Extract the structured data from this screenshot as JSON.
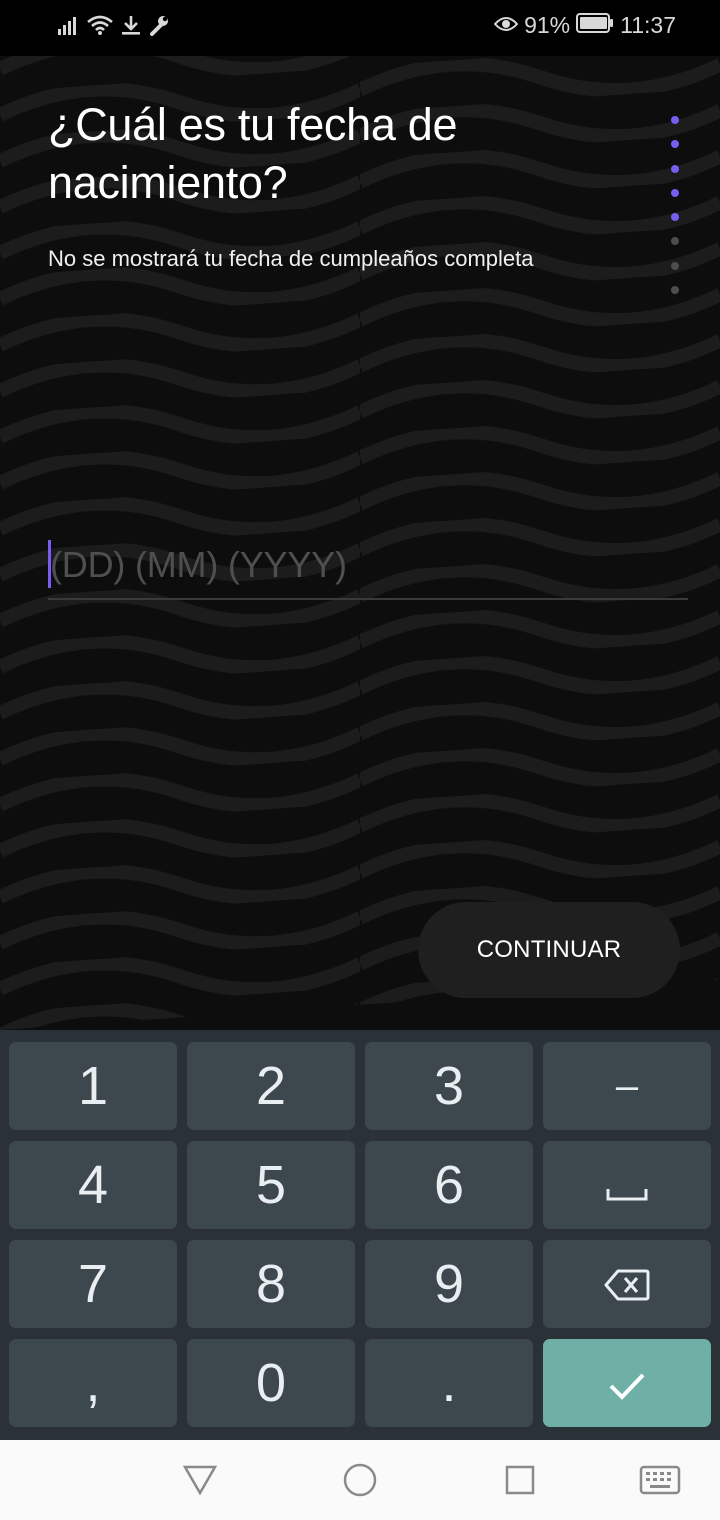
{
  "status_bar": {
    "battery_percent": "91%",
    "time": "11:37",
    "icons": [
      "signal-icon",
      "wifi-icon",
      "download-icon",
      "wrench-icon",
      "eye-icon",
      "battery-icon"
    ]
  },
  "screen": {
    "title": "¿Cuál es tu fecha de nacimiento?",
    "subtitle": "No se mostrará tu fecha de cumpleaños completa",
    "progress": {
      "total_steps": 8,
      "completed_steps": 5
    },
    "date_input": {
      "placeholder": "(DD) (MM) (YYYY)",
      "value": ""
    },
    "continue_label": "CONTINUAR"
  },
  "colors": {
    "accent": "#7b5cf0",
    "keyboard_bg": "#2a3237",
    "key_bg": "#3d474e",
    "enter_key": "#6fb0a6"
  },
  "keyboard": {
    "keys": [
      [
        "1",
        "2",
        "3",
        "–"
      ],
      [
        "4",
        "5",
        "6",
        "space-icon"
      ],
      [
        "7",
        "8",
        "9",
        "backspace-icon"
      ],
      [
        ",",
        "0",
        ".",
        "check-icon"
      ]
    ]
  },
  "nav_bar": {
    "buttons": [
      "back-icon",
      "home-icon",
      "recents-icon",
      "keyboard-icon"
    ]
  }
}
